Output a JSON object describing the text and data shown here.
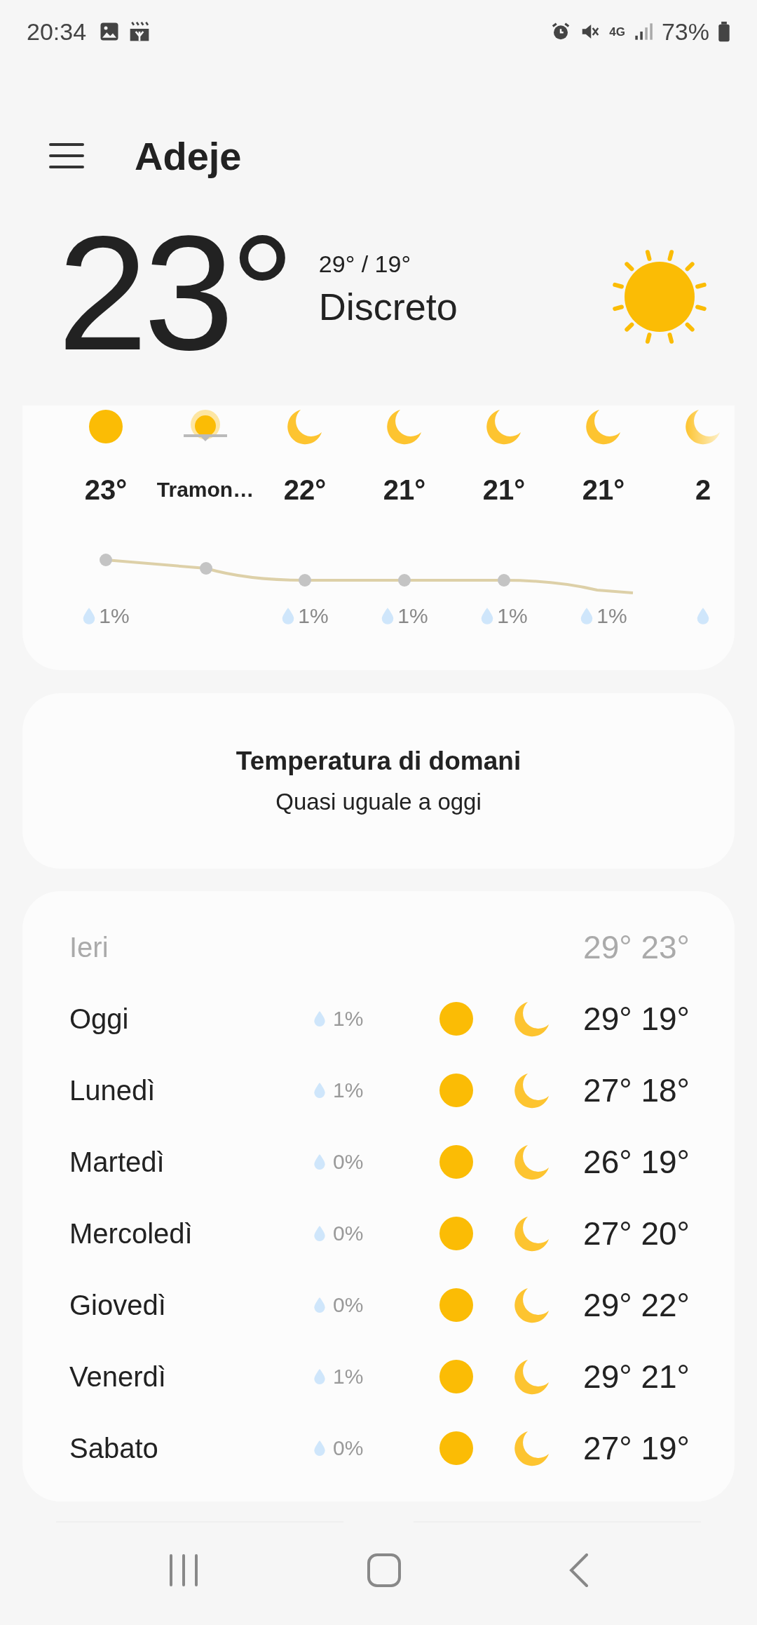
{
  "status_bar": {
    "time": "20:34",
    "network": "4G",
    "battery": "73%"
  },
  "header": {
    "city": "Adeje"
  },
  "current": {
    "temperature": "23°",
    "high_low": "29° / 19°",
    "condition": "Discreto",
    "kind": "sun"
  },
  "hourly": [
    {
      "kind": "sun",
      "label": "23°",
      "drop": true,
      "precip": "1%"
    },
    {
      "kind": "sunset",
      "label": "Tramon…",
      "drop": false
    },
    {
      "kind": "moon",
      "label": "22°",
      "drop": true,
      "precip": "1%"
    },
    {
      "kind": "moon",
      "label": "21°",
      "drop": true,
      "precip": "1%"
    },
    {
      "kind": "moon",
      "label": "21°",
      "drop": true,
      "precip": "1%"
    },
    {
      "kind": "moon",
      "label": "21°",
      "drop": true,
      "precip": "1%"
    },
    {
      "kind": "moon-faded",
      "label": "2",
      "drop": true
    }
  ],
  "tomorrow": {
    "title": "Temperatura di domani",
    "text": "Quasi uguale a oggi"
  },
  "daily": [
    {
      "kind": "past",
      "day": "Ieri",
      "temps": "29° 23°"
    },
    {
      "kind": "day",
      "day": "Oggi",
      "precip": "1%",
      "temps": "29° 19°"
    },
    {
      "kind": "day",
      "day": "Lunedì",
      "precip": "1%",
      "temps": "27° 18°"
    },
    {
      "kind": "day",
      "day": "Martedì",
      "precip": "0%",
      "temps": "26° 19°"
    },
    {
      "kind": "day",
      "day": "Mercoledì",
      "precip": "0%",
      "temps": "27° 20°"
    },
    {
      "kind": "day",
      "day": "Giovedì",
      "precip": "0%",
      "temps": "29° 22°"
    },
    {
      "kind": "day",
      "day": "Venerdì",
      "precip": "1%",
      "temps": "29° 21°"
    },
    {
      "kind": "day",
      "day": "Sabato",
      "precip": "0%",
      "temps": "27° 19°"
    }
  ]
}
